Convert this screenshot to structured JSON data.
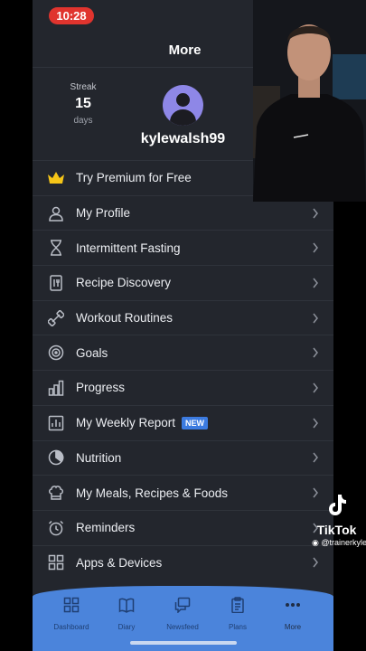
{
  "status": {
    "time": "10:28"
  },
  "header": {
    "title": "More"
  },
  "profile": {
    "streak_label": "Streak",
    "streak_value": "15",
    "streak_unit": "days",
    "username": "kylewalsh99"
  },
  "menu": {
    "items": [
      {
        "label": "Try Premium for Free",
        "icon": "crown-icon"
      },
      {
        "label": "My Profile",
        "icon": "person-icon"
      },
      {
        "label": "Intermittent Fasting",
        "icon": "hourglass-icon"
      },
      {
        "label": "Recipe Discovery",
        "icon": "recipe-book-icon"
      },
      {
        "label": "Workout Routines",
        "icon": "dumbbell-icon"
      },
      {
        "label": "Goals",
        "icon": "target-icon"
      },
      {
        "label": "Progress",
        "icon": "bar-chart-icon"
      },
      {
        "label": "My Weekly Report",
        "icon": "report-icon",
        "badge": "NEW"
      },
      {
        "label": "Nutrition",
        "icon": "pie-chart-icon"
      },
      {
        "label": "My Meals, Recipes & Foods",
        "icon": "chef-hat-icon"
      },
      {
        "label": "Reminders",
        "icon": "alarm-clock-icon"
      },
      {
        "label": "Apps & Devices",
        "icon": "apps-grid-icon"
      }
    ]
  },
  "tabbar": {
    "tabs": [
      {
        "label": "Dashboard",
        "icon": "dashboard-icon"
      },
      {
        "label": "Diary",
        "icon": "diary-icon"
      },
      {
        "label": "Newsfeed",
        "icon": "newsfeed-icon"
      },
      {
        "label": "Plans",
        "icon": "plans-icon"
      },
      {
        "label": "More",
        "icon": "more-dots-icon",
        "active": true
      }
    ]
  },
  "overlay": {
    "tiktok_logo": "TikTok",
    "tiktok_handle": "@trainerkyle"
  },
  "colors": {
    "accent": "#4b84db",
    "badge": "#3c7be0",
    "avatar": "#8e87e7",
    "crown": "#f5c518",
    "status_pill": "#e0342e"
  }
}
